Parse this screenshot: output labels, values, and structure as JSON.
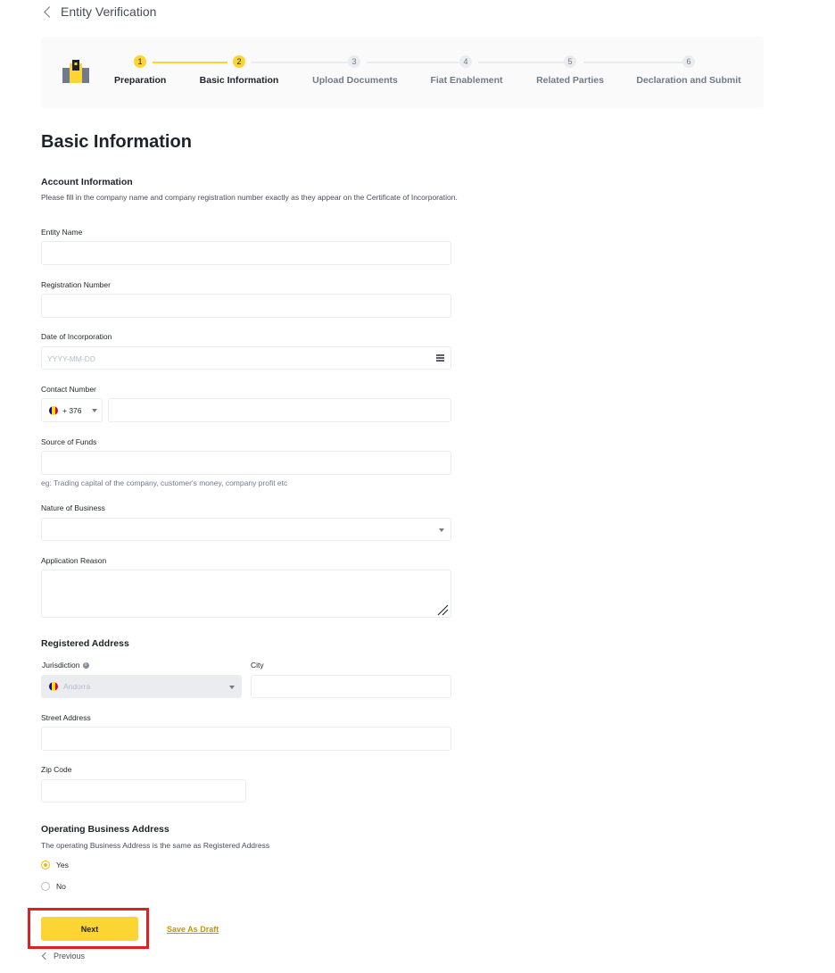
{
  "header": {
    "title": "Entity Verification"
  },
  "stepper": {
    "steps": [
      {
        "num": "1",
        "label": "Preparation",
        "state": "done"
      },
      {
        "num": "2",
        "label": "Basic Information",
        "state": "active"
      },
      {
        "num": "3",
        "label": "Upload Documents",
        "state": "todo"
      },
      {
        "num": "4",
        "label": "Fiat Enablement",
        "state": "todo"
      },
      {
        "num": "5",
        "label": "Related Parties",
        "state": "todo"
      },
      {
        "num": "6",
        "label": "Declaration and Submit",
        "state": "todo"
      }
    ]
  },
  "page_title": "Basic Information",
  "account": {
    "section_title": "Account Information",
    "helper": "Please fill in the company name and company registration number exactly as they appear on the Certificate of Incorporation.",
    "entity_name": {
      "label": "Entity Name",
      "value": ""
    },
    "registration_number": {
      "label": "Registration Number",
      "value": ""
    },
    "date_of_incorporation": {
      "label": "Date of Incorporation",
      "placeholder": "YYYY-MM-DD"
    },
    "contact_number": {
      "label": "Contact Number",
      "country_code": "+ 376",
      "value": ""
    },
    "source_of_funds": {
      "label": "Source of Funds",
      "value": "",
      "example": "eg: Trading capital of the company, customer's money, company profit etc"
    },
    "nature_of_business": {
      "label": "Nature of Business",
      "value": ""
    },
    "application_reason": {
      "label": "Application Reason",
      "value": ""
    }
  },
  "registered_address": {
    "section_title": "Registered Address",
    "jurisdiction": {
      "label": "Jurisdiction",
      "value": "Andorra"
    },
    "city": {
      "label": "City",
      "value": ""
    },
    "street_address": {
      "label": "Street Address",
      "value": ""
    },
    "zip_code": {
      "label": "Zip Code",
      "value": ""
    }
  },
  "operating_address": {
    "section_title": "Operating Business Address",
    "question": "The operating Business Address is the same as Registered Address",
    "options": [
      {
        "label": "Yes",
        "selected": true
      },
      {
        "label": "No",
        "selected": false
      }
    ]
  },
  "actions": {
    "next_label": "Next",
    "save_draft_label": "Save As Draft",
    "previous_label": "Previous"
  },
  "colors": {
    "accent": "#fcd535",
    "highlight": "#e02020",
    "link": "#c99400"
  },
  "icons": [
    "chevron-left-icon",
    "building-logo-icon",
    "calendar-icon",
    "andorra-flag-icon",
    "chevron-down-icon",
    "info-icon",
    "resize-handle-icon"
  ]
}
